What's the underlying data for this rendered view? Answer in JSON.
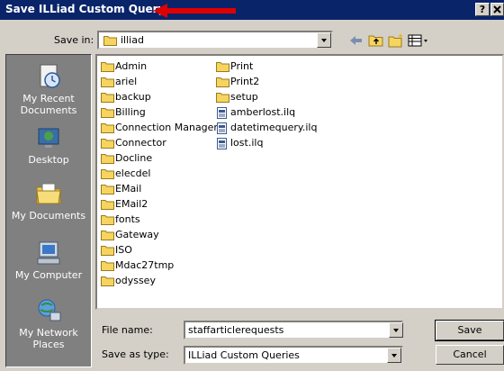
{
  "dialog": {
    "title": "Save ILLiad Custom Query",
    "help_label": "?",
    "accent": "#0a246a",
    "annotation_color": "#e00000"
  },
  "save_in": {
    "label": "Save in:",
    "value": "illiad"
  },
  "places": [
    {
      "label": "My Recent Documents",
      "icon": "recent-documents-icon"
    },
    {
      "label": "Desktop",
      "icon": "desktop-icon"
    },
    {
      "label": "My Documents",
      "icon": "my-documents-icon"
    },
    {
      "label": "My Computer",
      "icon": "my-computer-icon"
    },
    {
      "label": "My Network Places",
      "icon": "network-places-icon"
    }
  ],
  "files": {
    "column1": [
      "Admin",
      "ariel",
      "backup",
      "Billing",
      "Connection Manager",
      "Connector",
      "Docline",
      "elecdel",
      "EMail",
      "EMail2",
      "fonts",
      "Gateway",
      "ISO",
      "Mdac27tmp",
      "odyssey"
    ],
    "column2_folders": [
      "Print",
      "Print2",
      "setup"
    ],
    "column2_files": [
      "amberlost.ilq",
      "datetimequery.ilq",
      "lost.ilq"
    ]
  },
  "file_name": {
    "label": "File name:",
    "value": "staffarticlerequests"
  },
  "save_as_type": {
    "label": "Save as type:",
    "value": "ILLiad Custom Queries"
  },
  "buttons": {
    "save": "Save",
    "cancel": "Cancel"
  }
}
